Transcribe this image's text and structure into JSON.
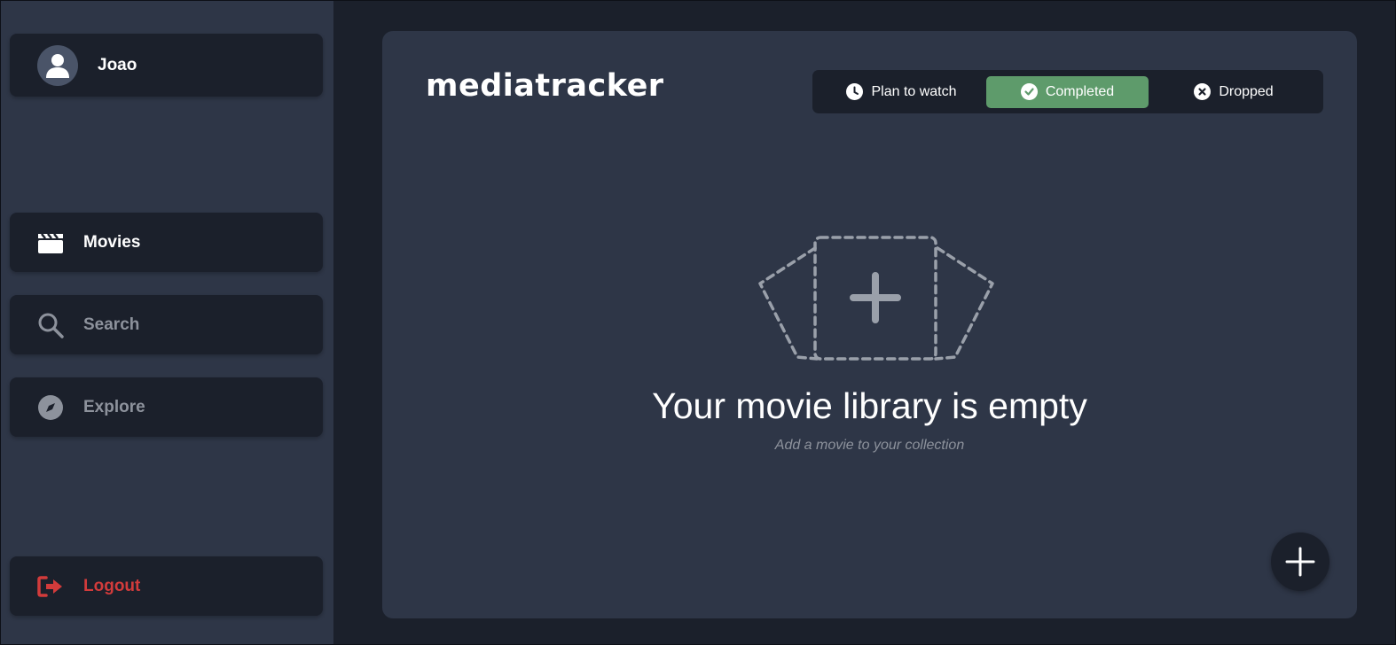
{
  "user": {
    "name": "Joao",
    "avatar_icon": "user-icon"
  },
  "nav": {
    "movies": {
      "label": "Movies",
      "icon": "clapperboard-icon"
    },
    "search": {
      "label": "Search",
      "icon": "search-icon"
    },
    "explore": {
      "label": "Explore",
      "icon": "compass-icon"
    },
    "logout": {
      "label": "Logout",
      "icon": "logout-icon"
    }
  },
  "brand": {
    "name": "mediatracker"
  },
  "tabs": [
    {
      "label": "Plan to watch",
      "icon": "clock-icon",
      "active": false
    },
    {
      "label": "Completed",
      "icon": "check-icon",
      "active": true
    },
    {
      "label": "Dropped",
      "icon": "x-circle-icon",
      "active": false
    }
  ],
  "empty_state": {
    "title": "Your movie library is empty",
    "subtitle": "Add a movie to your collection",
    "icon": "add-placeholder-icon"
  },
  "fab": {
    "icon": "plus-icon"
  },
  "colors": {
    "background": "#1b202b",
    "panel": "#2e3647",
    "accent_green": "#5e9b6b",
    "danger_red": "#d23b3b",
    "muted_text": "#8d929c"
  }
}
